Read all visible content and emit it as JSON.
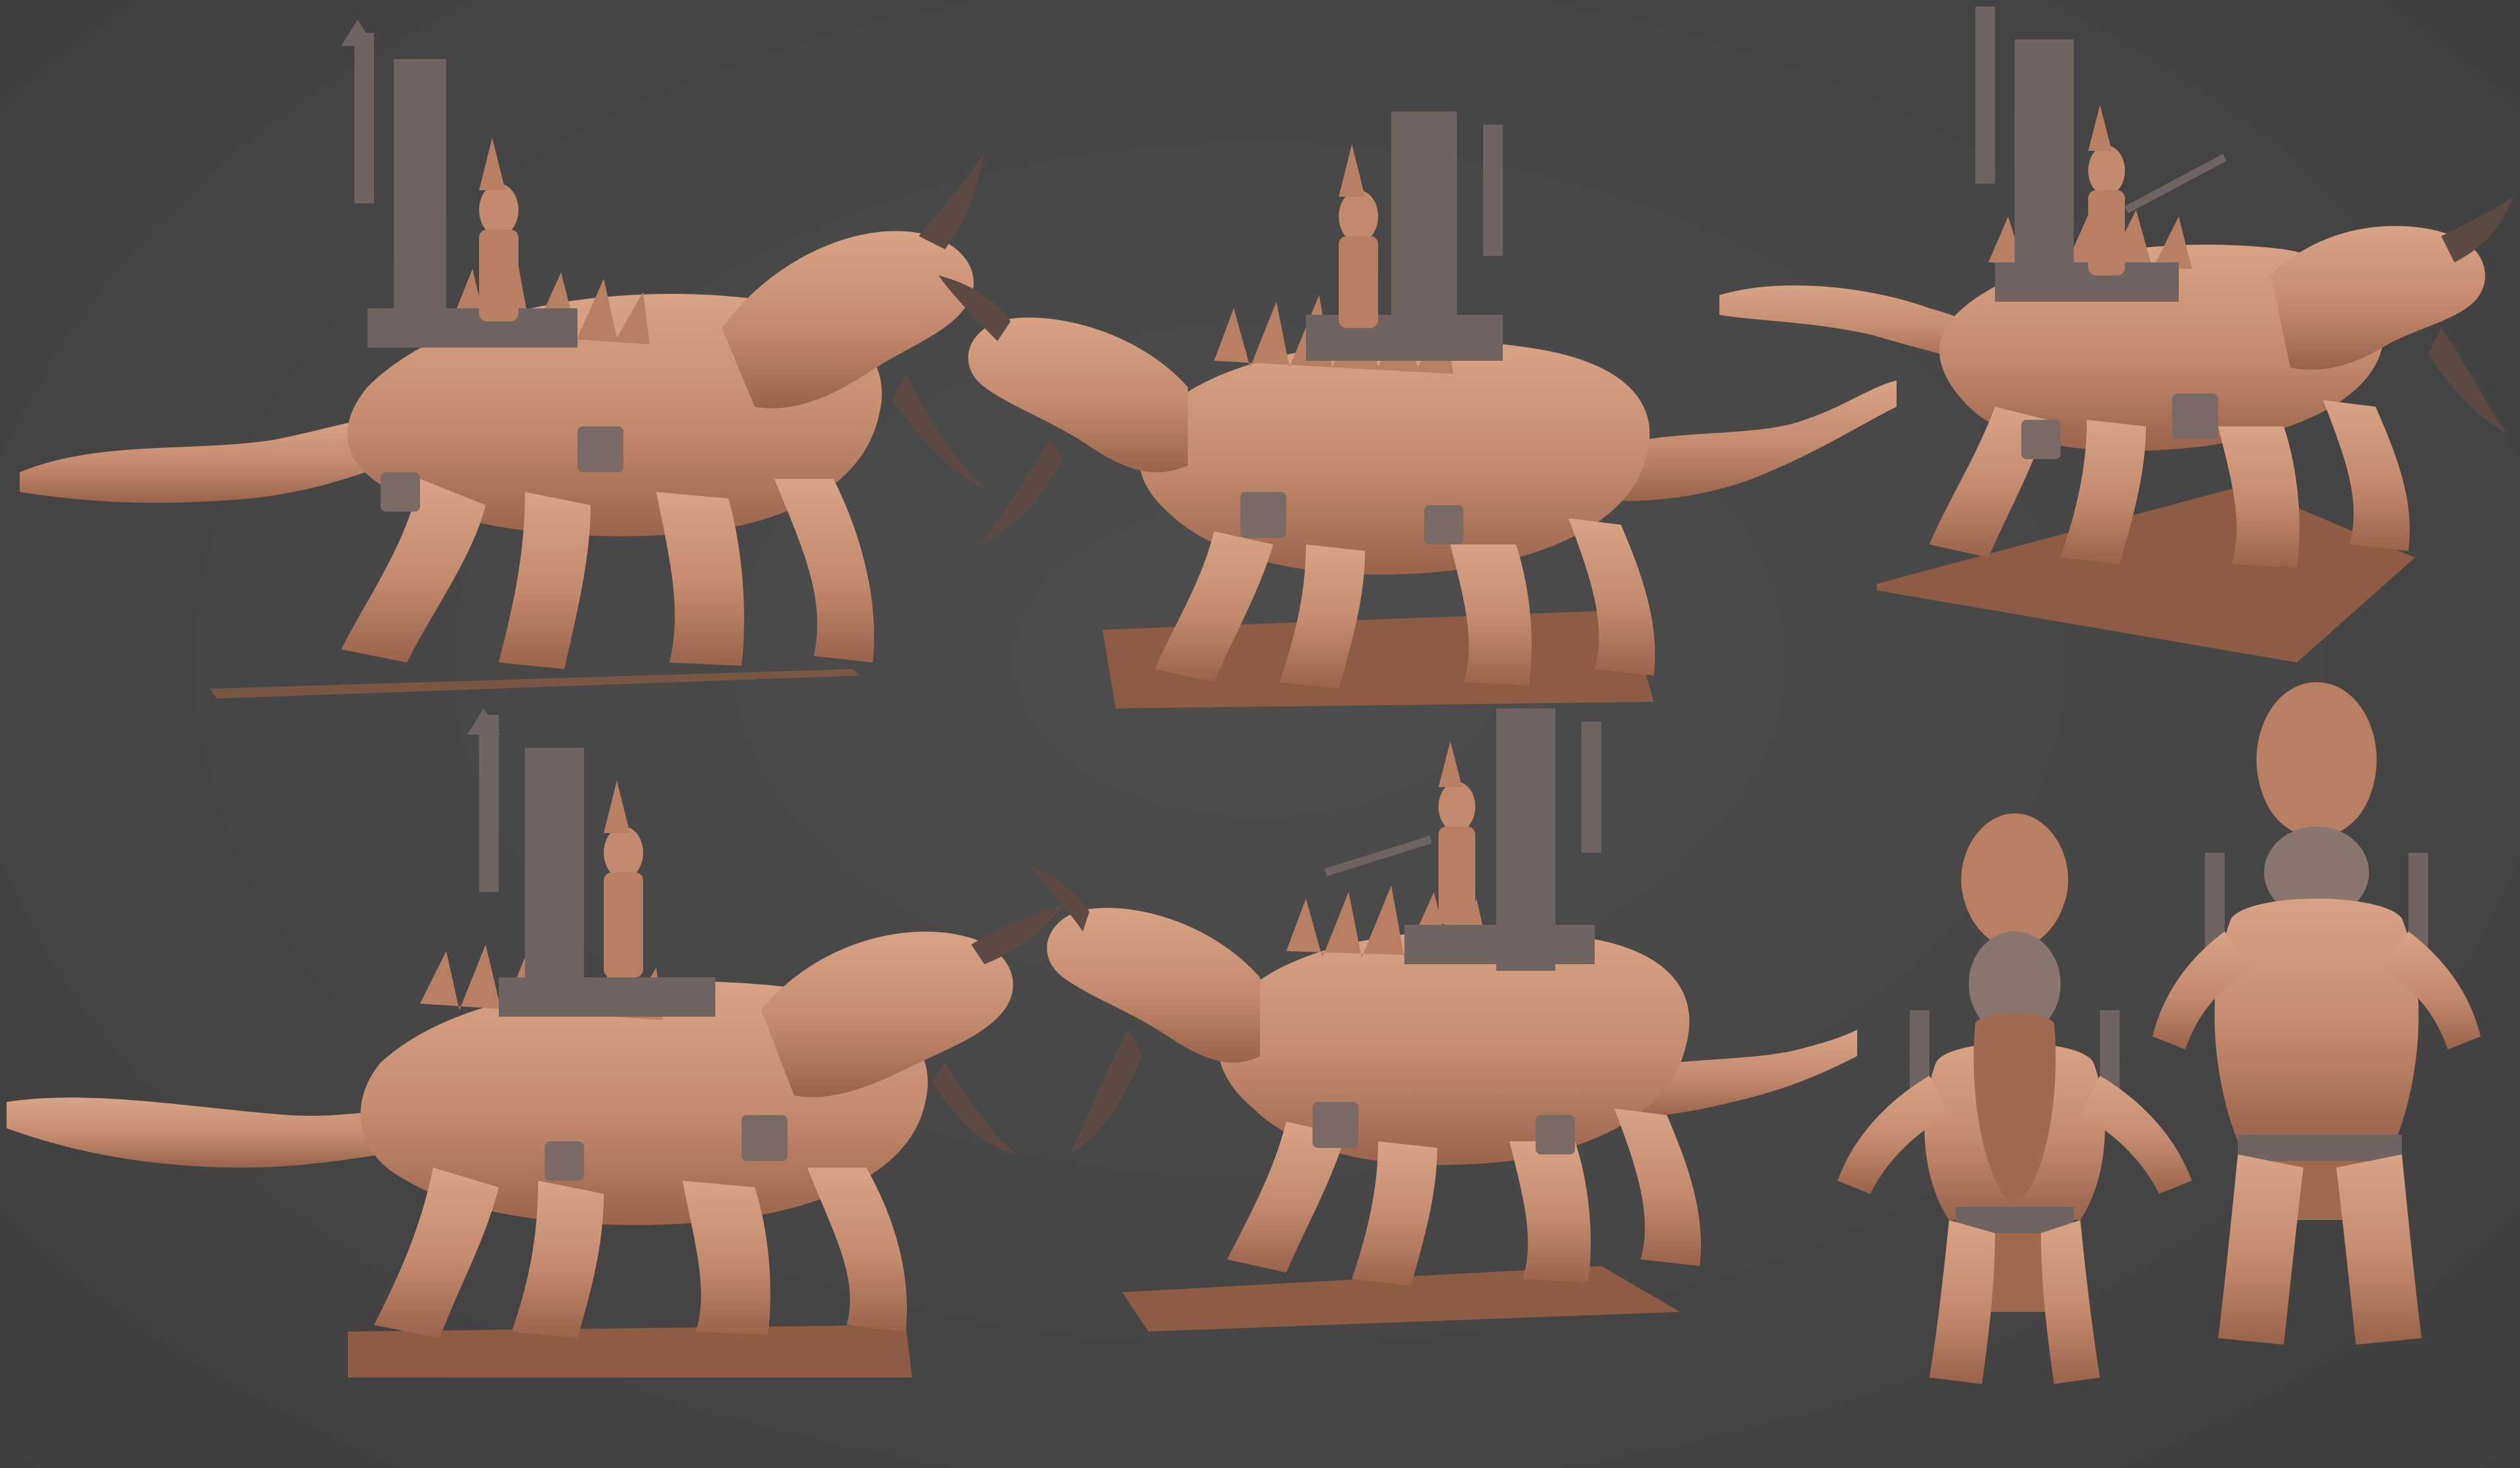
{
  "scene": {
    "background_color": "#474747",
    "clay_color": "#c48a6e",
    "clay_shadow_color": "#9a634a",
    "horn_color": "#5e4a44",
    "metal_color": "#6f6462",
    "base_color": "#8e5c45"
  },
  "renders": [
    {
      "name": "view-mount-left-1",
      "subject": "dragon-mount-with-rider",
      "facing": "right",
      "has_base": false
    },
    {
      "name": "view-mount-center-1",
      "subject": "dragon-mount-with-rider",
      "facing": "left",
      "has_base": true
    },
    {
      "name": "view-mount-right-1",
      "subject": "dragon-mount-with-rider",
      "facing": "right",
      "has_base": true
    },
    {
      "name": "view-mount-left-2",
      "subject": "dragon-mount-with-rider",
      "facing": "right",
      "has_base": true
    },
    {
      "name": "view-mount-center-2",
      "subject": "dragon-mount-with-rider",
      "facing": "left",
      "has_base": true
    },
    {
      "name": "view-rider-front",
      "subject": "dwarf-rider",
      "facing": "front",
      "has_base": false
    },
    {
      "name": "view-rider-back",
      "subject": "dwarf-rider",
      "facing": "back",
      "has_base": false
    }
  ]
}
